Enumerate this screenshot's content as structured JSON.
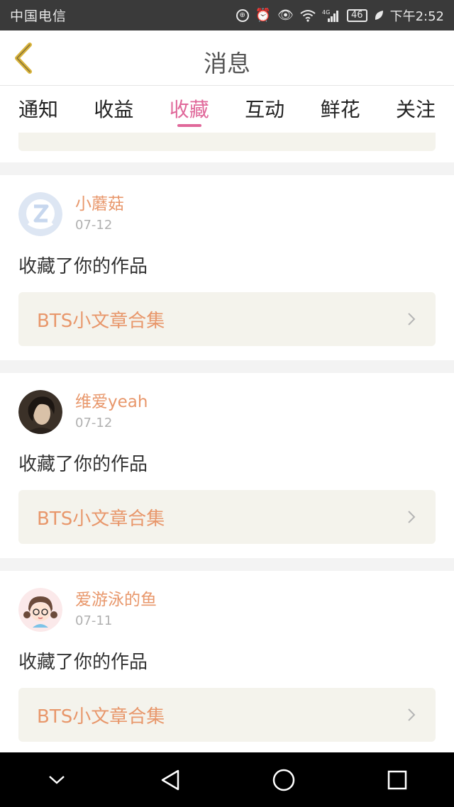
{
  "status_bar": {
    "carrier": "中国电信",
    "network": "4G",
    "battery": "46",
    "time": "下午2:52",
    "icons": [
      "hd-icon",
      "alarm-icon",
      "eye-icon",
      "wifi-icon",
      "signal-icon",
      "battery-icon",
      "leaf-icon"
    ]
  },
  "header": {
    "title": "消息",
    "back_icon": "chevron-left-icon"
  },
  "tabs": [
    {
      "label": "通知"
    },
    {
      "label": "收益"
    },
    {
      "label": "收藏",
      "active": true
    },
    {
      "label": "互动"
    },
    {
      "label": "鲜花"
    },
    {
      "label": "关注"
    }
  ],
  "feed": [
    {
      "user": "小蘑菇",
      "date": "07-12",
      "action": "收藏了你的作品",
      "work": "BTS小文章合集"
    },
    {
      "user": "维爱yeah",
      "date": "07-12",
      "action": "收藏了你的作品",
      "work": "BTS小文章合集"
    },
    {
      "user": "爱游泳的鱼",
      "date": "07-11",
      "action": "收藏了你的作品",
      "work": "BTS小文章合集"
    }
  ],
  "colors": {
    "accent": "#e0689a",
    "username": "#e8976b",
    "work_bg": "#f4f3ec",
    "back_arrow": "#d9b33a"
  },
  "nav_bar": {
    "icons": [
      "chevron-down-icon",
      "back-triangle-icon",
      "home-circle-icon",
      "recents-square-icon"
    ]
  }
}
